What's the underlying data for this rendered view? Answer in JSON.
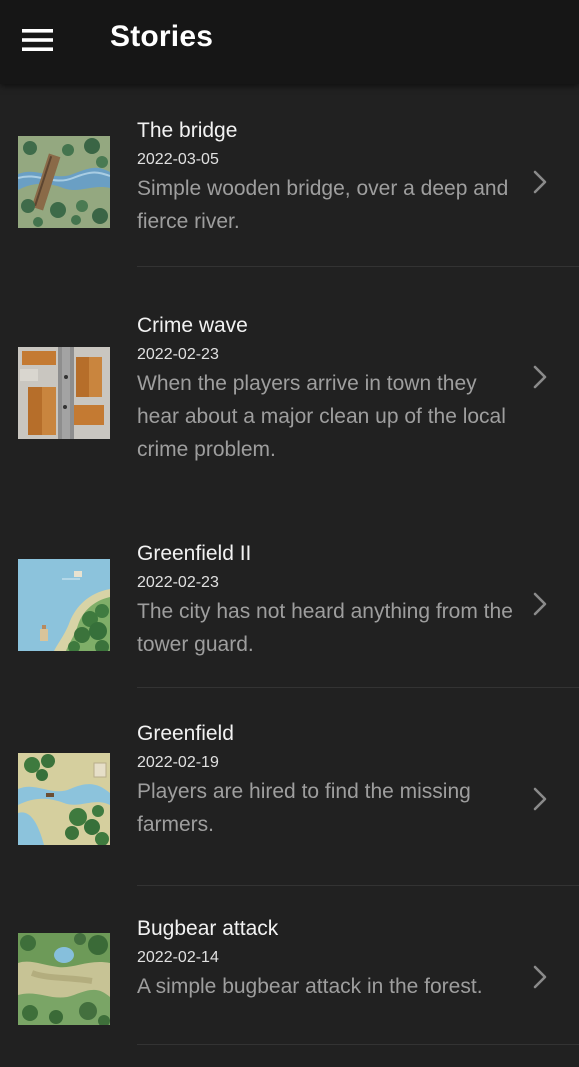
{
  "app_bar": {
    "title": "Stories",
    "menu_icon": "hamburger-menu-icon"
  },
  "stories": [
    {
      "title": "The bridge",
      "date": "2022-03-05",
      "description": "Simple wooden bridge, over a deep and fierce river."
    },
    {
      "title": "Crime wave",
      "date": "2022-02-23",
      "description": "When the players arrive in town they hear about a major clean up of the local crime problem."
    },
    {
      "title": "Greenfield II",
      "date": "2022-02-23",
      "description": "The city has not heard anything from the tower guard."
    },
    {
      "title": "Greenfield",
      "date": "2022-02-19",
      "description": "Players are hired to find the missing farmers."
    },
    {
      "title": "Bugbear attack",
      "date": "2022-02-14",
      "description": "A simple bugbear attack in the forest."
    }
  ],
  "colors": {
    "background": "#212121",
    "app_bar": "#161616",
    "title_text": "#ffffff",
    "description_text": "#9e9e9e",
    "chevron": "#8a8a8a"
  }
}
